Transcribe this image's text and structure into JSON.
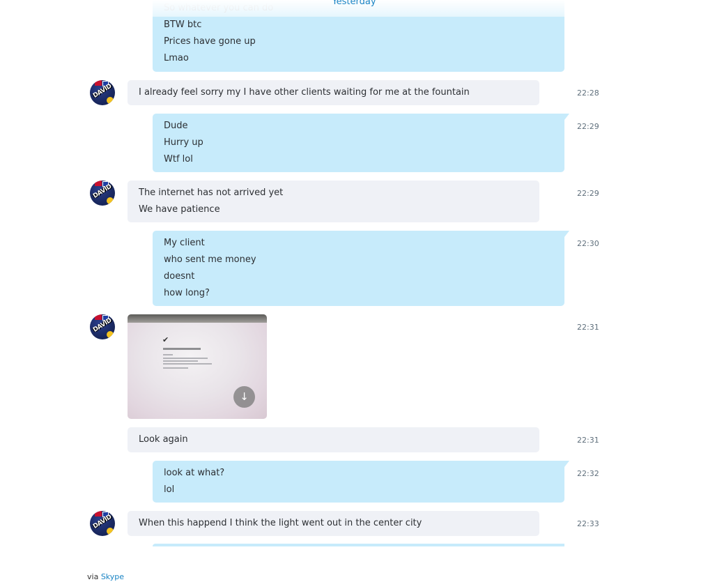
{
  "date_separator": "Yesterday",
  "messages": [
    {
      "kind": "out",
      "lines": [
        "So whatever you can do",
        "BTW btc",
        "Prices have gone up",
        "Lmao"
      ]
    },
    {
      "kind": "in",
      "time": "22:28",
      "lines": [
        "I already feel sorry my I have other clients waiting for me at the fountain"
      ]
    },
    {
      "kind": "out",
      "time": "22:29",
      "lines": [
        "Dude",
        "Hurry up",
        "Wtf lol"
      ]
    },
    {
      "kind": "in",
      "time": "22:29",
      "lines": [
        "The internet has not arrived yet",
        "We have patience"
      ]
    },
    {
      "kind": "out",
      "time": "22:30",
      "lines": [
        "My client",
        "who sent me money",
        "doesnt",
        "how long?"
      ]
    },
    {
      "kind": "in-image",
      "time": "22:31"
    },
    {
      "kind": "in",
      "time": "22:31",
      "lines": [
        "Look again"
      ]
    },
    {
      "kind": "out",
      "time": "22:32",
      "lines": [
        "look at what?",
        "lol"
      ]
    },
    {
      "kind": "in",
      "time": "22:33",
      "lines": [
        "When this happend I think the light went out in the center city"
      ]
    }
  ],
  "avatar_text": "DAVID",
  "icons": {
    "download": "download-arrow-icon",
    "checkmark": "checkmark-icon"
  },
  "footer": {
    "prefix": "via",
    "link": "Skype"
  },
  "colors": {
    "outgoing_bubble": "#c7ebfb",
    "incoming_bubble": "#eff1f6",
    "link": "#1a84c4"
  }
}
